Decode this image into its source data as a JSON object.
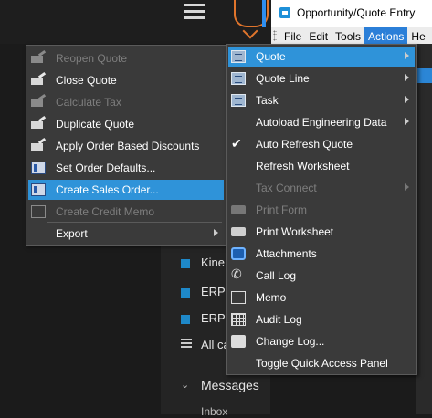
{
  "window": {
    "title": "Opportunity/Quote Entry"
  },
  "menubar": {
    "items": [
      "File",
      "Edit",
      "Tools",
      "Actions",
      "He"
    ],
    "active": "Actions"
  },
  "background": {
    "side_items": [
      "Kine",
      "ERP",
      "ERP",
      "All ca"
    ],
    "messages": "Messages",
    "inbox": "Inbox"
  },
  "left_menu": {
    "items": [
      {
        "label": "Reopen Quote",
        "icon": "folder-edit-icon",
        "disabled": true
      },
      {
        "label": "Close Quote",
        "icon": "folder-edit-icon",
        "disabled": false
      },
      {
        "label": "Calculate Tax",
        "icon": "folder-edit-icon",
        "disabled": true
      },
      {
        "label": "Duplicate Quote",
        "icon": "folder-edit-icon",
        "disabled": false
      },
      {
        "label": "Apply Order Based Discounts",
        "icon": "folder-edit-icon",
        "disabled": false
      },
      {
        "label": "Set Order Defaults...",
        "icon": "form-grid-icon",
        "disabled": false
      },
      {
        "label": "Create Sales Order...",
        "icon": "form-grid-icon",
        "disabled": false,
        "highlighted": true
      },
      {
        "label": "Create Credit Memo",
        "icon": "window-icon",
        "disabled": true
      },
      {
        "label": "Export",
        "icon": "",
        "disabled": false,
        "submenu": true
      }
    ]
  },
  "right_menu": {
    "items": [
      {
        "label": "Quote",
        "icon": "document-icon",
        "submenu": true,
        "highlighted": true
      },
      {
        "label": "Quote Line",
        "icon": "document-icon",
        "submenu": true
      },
      {
        "label": "Task",
        "icon": "document-icon",
        "submenu": true
      },
      {
        "label": "Autoload Engineering Data",
        "icon": "",
        "submenu": true
      },
      {
        "label": "Auto Refresh Quote",
        "icon": "checkmark-icon",
        "checked": true
      },
      {
        "label": "Refresh Worksheet",
        "icon": ""
      },
      {
        "label": "Tax Connect",
        "icon": "",
        "submenu": true,
        "disabled": true
      },
      {
        "label": "Print Form",
        "icon": "printer-icon",
        "disabled": true
      },
      {
        "label": "Print Worksheet",
        "icon": "printer-icon"
      },
      {
        "label": "Attachments",
        "icon": "paperclip-icon"
      },
      {
        "label": "Call Log",
        "icon": "phone-icon"
      },
      {
        "label": "Memo",
        "icon": "memo-icon"
      },
      {
        "label": "Audit Log",
        "icon": "audit-log-icon"
      },
      {
        "label": "Change Log...",
        "icon": "change-log-icon"
      },
      {
        "label": "Toggle Quick Access Panel",
        "icon": ""
      }
    ]
  },
  "colors": {
    "highlight": "#2f93d9",
    "menu_bg": "#3a3a3a",
    "accent_orange": "#e0752c"
  }
}
